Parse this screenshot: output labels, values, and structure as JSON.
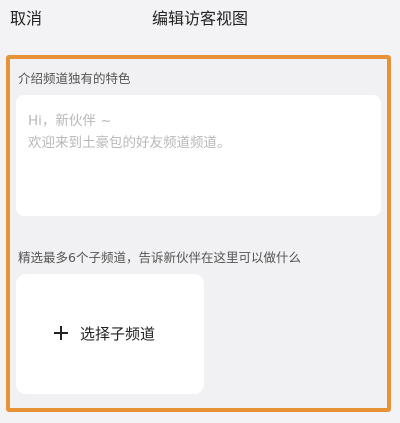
{
  "header": {
    "cancel_label": "取消",
    "title": "编辑访客视图"
  },
  "intro": {
    "label": "介绍频道独有的特色",
    "placeholder_line1": "Hi，新伙伴 ~",
    "placeholder_line2": "欢迎来到土豪包的好友频道频道。"
  },
  "subchannels": {
    "label": "精选最多6个子频道，告诉新伙伴在这里可以做什么",
    "select_button_label": "选择子频道"
  },
  "colors": {
    "highlight_border": "#e89238",
    "background": "#f3f3f5",
    "placeholder_text": "#b8b8b8"
  }
}
